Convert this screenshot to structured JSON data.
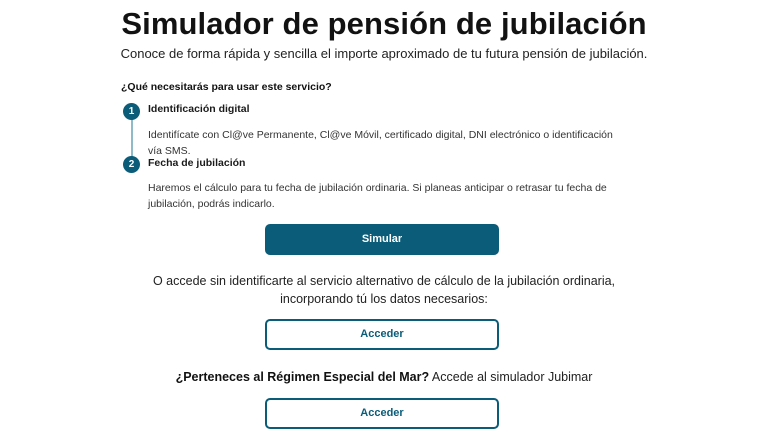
{
  "header": {
    "title": "Simulador de pensión de jubilación",
    "subtitle": "Conoce de forma rápida y sencilla el importe aproximado de tu futura pensión de jubilación."
  },
  "requirements": {
    "question": "¿Qué necesitarás para usar este servicio?",
    "steps": [
      {
        "number": "1",
        "title": "Identificación digital",
        "text": "Identifícate con Cl@ve Permanente, Cl@ve Móvil, certificado digital, DNI electrónico o identificación vía SMS."
      },
      {
        "number": "2",
        "title": "Fecha de jubilación",
        "text": "Haremos el cálculo para tu fecha de jubilación ordinaria. Si planeas anticipar o retrasar tu fecha de jubilación, podrás indicarlo."
      }
    ]
  },
  "actions": {
    "simulate_label": "Simular",
    "alternative_text": "O accede sin identificarte al servicio alternativo de cálculo de la jubilación ordinaria, incorporando tú los datos necesarios:",
    "access_label_1": "Acceder",
    "mar_question": "¿Perteneces al Régimen Especial del Mar?",
    "mar_text": " Accede al simulador Jubimar",
    "access_label_2": "Acceder"
  },
  "colors": {
    "primary": "#0b5c78",
    "timeline": "#8fbac7",
    "text": "#1a1a1a"
  }
}
